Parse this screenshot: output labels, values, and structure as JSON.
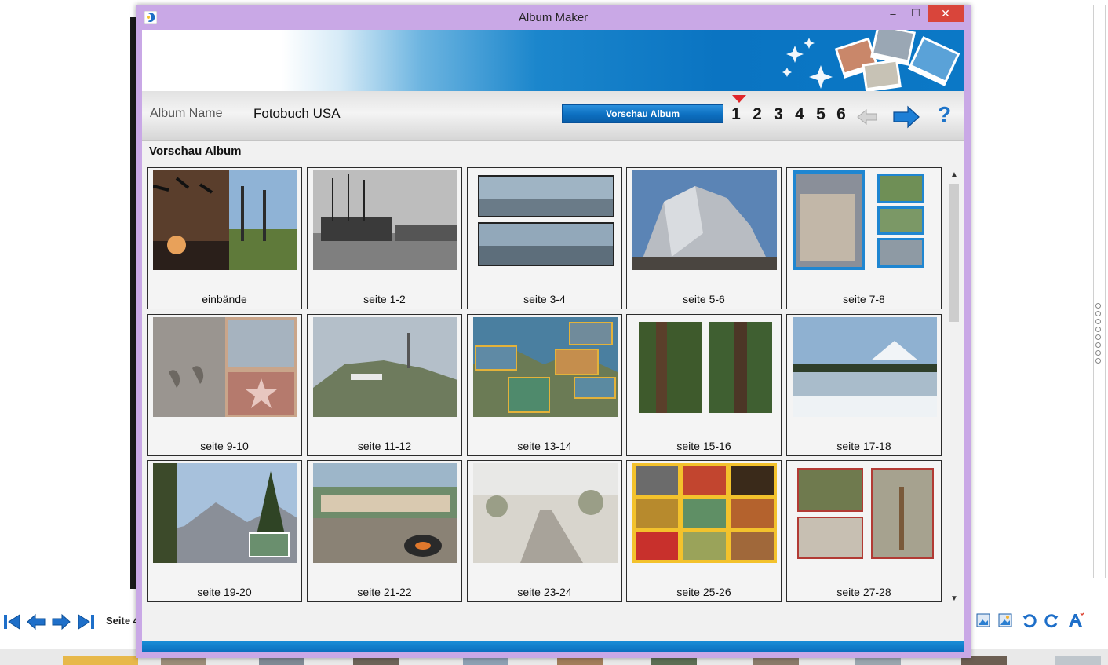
{
  "window": {
    "title": "Album Maker",
    "minimize": "–",
    "maximize": "☐",
    "close": "✕"
  },
  "header": {
    "album_name_label": "Album Name",
    "album_name_value": "Fotobuch USA",
    "preview_button": "Vorschau Album",
    "steps": [
      "1",
      "2",
      "3",
      "4",
      "5",
      "6"
    ],
    "active_step": "1",
    "help": "?"
  },
  "section_title": "Vorschau Album",
  "pages": [
    {
      "label": "einbände"
    },
    {
      "label": "seite 1-2"
    },
    {
      "label": "seite 3-4"
    },
    {
      "label": "seite 5-6"
    },
    {
      "label": "seite 7-8"
    },
    {
      "label": "seite 9-10"
    },
    {
      "label": "seite 11-12"
    },
    {
      "label": "seite 13-14"
    },
    {
      "label": "seite 15-16"
    },
    {
      "label": "seite 17-18"
    },
    {
      "label": "seite 19-20"
    },
    {
      "label": "seite 21-22"
    },
    {
      "label": "seite 23-24"
    },
    {
      "label": "seite 25-26"
    },
    {
      "label": "seite 27-28"
    }
  ],
  "background_app": {
    "page_label": "Seite 4"
  },
  "colors": {
    "window_frame": "#c9a8e6",
    "accent_blue": "#0a74c2",
    "close_red": "#d9453b"
  }
}
